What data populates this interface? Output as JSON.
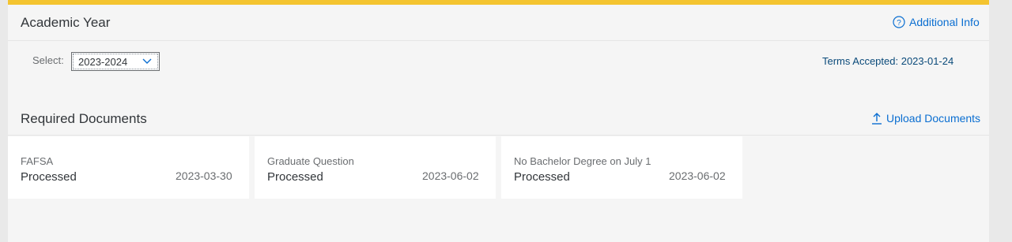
{
  "academic_year": {
    "title": "Academic Year",
    "additional_info_label": "Additional Info",
    "select_label": "Select:",
    "selected_year": "2023-2024",
    "terms_accepted": "Terms Accepted: 2023-01-24"
  },
  "required_documents": {
    "title": "Required Documents",
    "upload_label": "Upload Documents",
    "cards": [
      {
        "name": "FAFSA",
        "status": "Processed",
        "date": "2023-03-30"
      },
      {
        "name": "Graduate Question",
        "status": "Processed",
        "date": "2023-06-02"
      },
      {
        "name": "No Bachelor Degree on July 1",
        "status": "Processed",
        "date": "2023-06-02"
      }
    ]
  },
  "colors": {
    "accent_bar": "#f4c430",
    "link": "#0a6ed1"
  },
  "icons": {
    "info": "question-circle-icon",
    "upload": "upload-icon",
    "dropdown": "chevron-down-icon"
  }
}
